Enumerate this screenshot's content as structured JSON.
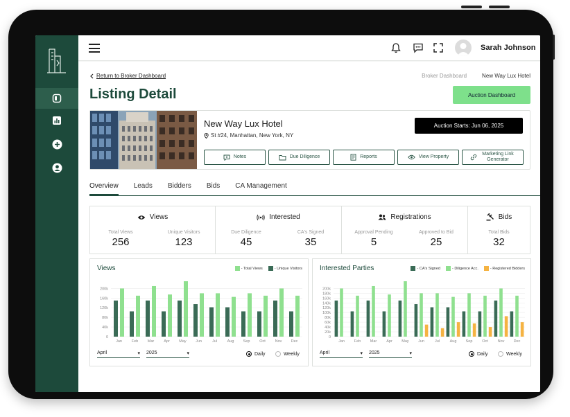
{
  "user": {
    "name": "Sarah Johnson"
  },
  "nav": {
    "back_label": "Return to Broker Dashboard",
    "breadcrumbs": [
      "Broker Dashboard",
      "New Way Lux Hotel"
    ]
  },
  "page": {
    "title": "Listing Detail",
    "auction_dashboard_label": "Auction Dashboard"
  },
  "property": {
    "name": "New Way Lux Hotel",
    "address": "St #24, Manhattan, New York, NY",
    "auction_start": "Auction Starts: Jun 06, 2025",
    "actions": [
      {
        "label": "Notes",
        "icon": "notes-icon"
      },
      {
        "label": "Due Diligence",
        "icon": "folder-icon"
      },
      {
        "label": "Reports",
        "icon": "report-icon"
      },
      {
        "label": "View Property",
        "icon": "eye-icon"
      },
      {
        "label": "Marketing Link Generator",
        "icon": "link-icon"
      }
    ]
  },
  "tabs": [
    "Overview",
    "Leads",
    "Bidders",
    "Bids",
    "CA Management"
  ],
  "stats": [
    {
      "title": "Views",
      "icon": "eye-icon",
      "metrics": [
        {
          "label": "Total Views",
          "value": "256"
        },
        {
          "label": "Unique Visitors",
          "value": "123"
        }
      ]
    },
    {
      "title": "Interested",
      "icon": "signal-icon",
      "metrics": [
        {
          "label": "Due Diligence",
          "value": "45"
        },
        {
          "label": "CA's Signed",
          "value": "35"
        }
      ]
    },
    {
      "title": "Registrations",
      "icon": "users-icon",
      "metrics": [
        {
          "label": "Approval Pending",
          "value": "5"
        },
        {
          "label": "Approved to Bid",
          "value": "25"
        }
      ]
    },
    {
      "title": "Bids",
      "icon": "gavel-icon",
      "metrics": [
        {
          "label": "Total Bids",
          "value": "32"
        }
      ]
    }
  ],
  "colors": {
    "dark_green": "#3a6b56",
    "light_green": "#8fe08f",
    "orange": "#f5b342",
    "brand": "#1d4a3b",
    "accent": "#7ee08b"
  },
  "controls": {
    "month": "April",
    "year": "2025",
    "daily": "Daily",
    "weekly": "Weekly"
  },
  "chart_data": [
    {
      "type": "bar",
      "title": "Views",
      "categories": [
        "Jan",
        "Feb",
        "Mar",
        "Apr",
        "May",
        "Jun",
        "Jul",
        "Aug",
        "Sep",
        "Oct",
        "Nov",
        "Dec"
      ],
      "yticks": [
        "0",
        "40k",
        "80k",
        "120k",
        "160k",
        "200k"
      ],
      "ylim": [
        0,
        230000
      ],
      "legend_position": "top-right",
      "series": [
        {
          "name": "- Unique Visitors",
          "color": "#3a6b56",
          "values": [
            150000,
            105000,
            150000,
            105000,
            150000,
            135000,
            122000,
            122000,
            105000,
            105000,
            150000,
            105000
          ]
        },
        {
          "name": "- Total Views",
          "color": "#8fe08f",
          "values": [
            200000,
            170000,
            210000,
            175000,
            230000,
            180000,
            180000,
            165000,
            180000,
            170000,
            200000,
            170000
          ]
        }
      ]
    },
    {
      "type": "bar",
      "title": "Interested Parties",
      "categories": [
        "Jan",
        "Feb",
        "Mar",
        "Apr",
        "May",
        "Jun",
        "Jul",
        "Aug",
        "Sep",
        "Oct",
        "Nov",
        "Dec"
      ],
      "yticks": [
        "0",
        "20k",
        "40k",
        "60k",
        "80k",
        "100k",
        "120k",
        "140k",
        "160k",
        "180k",
        "200k"
      ],
      "ylim": [
        0,
        230000
      ],
      "legend_position": "top-right",
      "series": [
        {
          "name": "- CA's Signed",
          "color": "#3a6b56",
          "values": [
            150000,
            105000,
            150000,
            105000,
            150000,
            135000,
            122000,
            122000,
            105000,
            105000,
            150000,
            105000
          ]
        },
        {
          "name": "- Diligence Acc.",
          "color": "#8fe08f",
          "values": [
            200000,
            170000,
            210000,
            175000,
            230000,
            180000,
            180000,
            165000,
            180000,
            170000,
            200000,
            170000
          ]
        },
        {
          "name": "- Registered Bidders",
          "color": "#f5b342",
          "values": [
            0,
            0,
            0,
            0,
            0,
            50000,
            35000,
            60000,
            55000,
            40000,
            85000,
            60000
          ]
        }
      ]
    }
  ]
}
